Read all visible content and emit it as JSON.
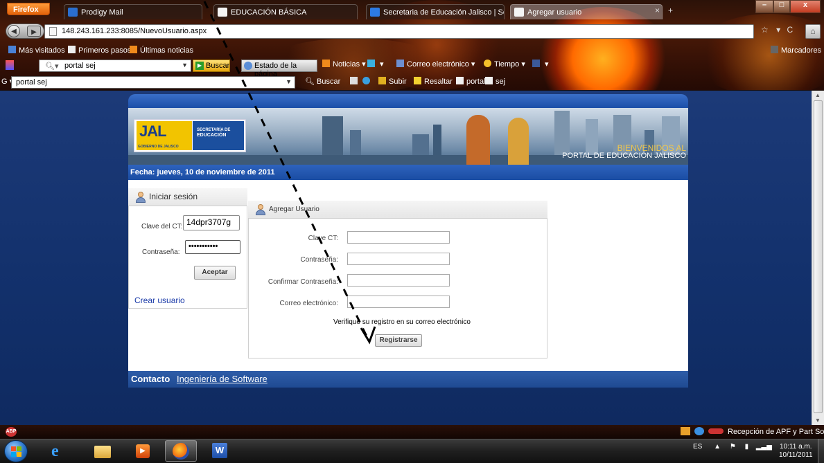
{
  "browser": {
    "menu_button": "Firefox",
    "tabs": [
      {
        "label": "Prodigy Mail",
        "icon": "mail-icon",
        "active": false
      },
      {
        "label": "EDUCACIÓN BÁSICA",
        "icon": "page-icon",
        "active": false
      },
      {
        "label": "Secretaria de Educación Jalisco | Secr...",
        "icon": "site-icon",
        "active": false
      },
      {
        "label": "Agregar usuario",
        "icon": "page-icon",
        "active": true
      }
    ],
    "url": "148.243.161.233:8085/NuevoUsuario.aspx",
    "bookmarks": [
      "Más visitados",
      "Primeros pasos",
      "Últimas noticias"
    ],
    "bookmarks_menu": "Marcadores",
    "toolbar1": {
      "search_value": "portal sej",
      "buscar": "Buscar",
      "estado": "Estado de la página",
      "noticias": "Noticias",
      "correo": "Correo electrónico",
      "tiempo": "Tiempo"
    },
    "toolbar2": {
      "search_value": "portal sej",
      "buscar": "Buscar",
      "subir": "Subir",
      "resaltar": "Resaltar",
      "portal": "portal",
      "sej": "sej"
    }
  },
  "page": {
    "logo": {
      "jal": "JAL",
      "gobierno": "GOBIERNO DE JALISCO",
      "secretaria": "SECRETARÍA DE",
      "educacion": "EDUCACIÓN"
    },
    "bienvenidos": "BIENVENIDOS AL",
    "portal": "PORTAL DE EDUCACIÓN JALISCO",
    "fecha": "Fecha: jueves, 10 de noviembre de 2011",
    "login": {
      "title": "Iniciar sesión",
      "clave_label": "Clave del CT:",
      "clave_value": "14dpr3707g",
      "password_label": "Contraseña:",
      "password_value": "•••••••••••",
      "aceptar": "Aceptar",
      "crear_usuario": "Crear usuario"
    },
    "agregar": {
      "title": "Agregar Usuario",
      "clave_label": "Clave CT:",
      "password_label": "Contraseña:",
      "confirm_label": "Confirmar Contraseña:",
      "email_label": "Correo electrónico:",
      "verifique": "Verifique su registro en su correo electrónico",
      "registrarse": "Registrarse"
    },
    "footer": {
      "contacto": "Contacto",
      "link": "Ingeniería de Software"
    }
  },
  "statusbar": {
    "addon": "ABP",
    "right_text": "Recepción de APF y Part Soc"
  },
  "taskbar": {
    "lang": "ES",
    "time": "10:11 a.m.",
    "date": "10/11/2011"
  },
  "colors": {
    "site_blue": "#1a4da3",
    "accent_orange": "#ff6a00",
    "link_blue": "#1a3aa8"
  }
}
